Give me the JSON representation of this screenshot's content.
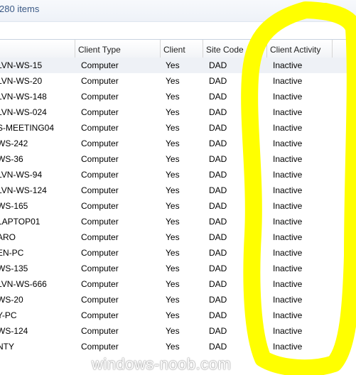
{
  "status": {
    "item_count": "280 items"
  },
  "columns": [
    "Client Type",
    "Client",
    "Site Code",
    "Client Activity"
  ],
  "rows": [
    {
      "name": "LVN-WS-15",
      "client_type": "Computer",
      "client": "Yes",
      "site_code": "DAD",
      "activity": "Inactive"
    },
    {
      "name": "LVN-WS-20",
      "client_type": "Computer",
      "client": "Yes",
      "site_code": "DAD",
      "activity": "Inactive"
    },
    {
      "name": "LVN-WS-148",
      "client_type": "Computer",
      "client": "Yes",
      "site_code": "DAD",
      "activity": "Inactive"
    },
    {
      "name": "LVN-WS-024",
      "client_type": "Computer",
      "client": "Yes",
      "site_code": "DAD",
      "activity": "Inactive"
    },
    {
      "name": "S-MEETING04",
      "client_type": "Computer",
      "client": "Yes",
      "site_code": "DAD",
      "activity": "Inactive"
    },
    {
      "name": "WS-242",
      "client_type": "Computer",
      "client": "Yes",
      "site_code": "DAD",
      "activity": "Inactive"
    },
    {
      "name": "WS-36",
      "client_type": "Computer",
      "client": "Yes",
      "site_code": "DAD",
      "activity": "Inactive"
    },
    {
      "name": "LVN-WS-94",
      "client_type": "Computer",
      "client": "Yes",
      "site_code": "DAD",
      "activity": "Inactive"
    },
    {
      "name": "LVN-WS-124",
      "client_type": "Computer",
      "client": "Yes",
      "site_code": "DAD",
      "activity": "Inactive"
    },
    {
      "name": "WS-165",
      "client_type": "Computer",
      "client": "Yes",
      "site_code": "DAD",
      "activity": "Inactive"
    },
    {
      "name": "LAPTOP01",
      "client_type": "Computer",
      "client": "Yes",
      "site_code": "DAD",
      "activity": "Inactive"
    },
    {
      "name": "ARO",
      "client_type": "Computer",
      "client": "Yes",
      "site_code": "DAD",
      "activity": "Inactive"
    },
    {
      "name": "EN-PC",
      "client_type": "Computer",
      "client": "Yes",
      "site_code": "DAD",
      "activity": "Inactive"
    },
    {
      "name": "WS-135",
      "client_type": "Computer",
      "client": "Yes",
      "site_code": "DAD",
      "activity": "Inactive"
    },
    {
      "name": "LVN-WS-666",
      "client_type": "Computer",
      "client": "Yes",
      "site_code": "DAD",
      "activity": "Inactive"
    },
    {
      "name": "WS-20",
      "client_type": "Computer",
      "client": "Yes",
      "site_code": "DAD",
      "activity": "Inactive"
    },
    {
      "name": "Y-PC",
      "client_type": "Computer",
      "client": "Yes",
      "site_code": "DAD",
      "activity": "Inactive"
    },
    {
      "name": "WS-124",
      "client_type": "Computer",
      "client": "Yes",
      "site_code": "DAD",
      "activity": "Inactive"
    },
    {
      "name": "NTY",
      "client_type": "Computer",
      "client": "Yes",
      "site_code": "DAD",
      "activity": "Inactive"
    }
  ],
  "watermark": "windows-noob.com",
  "colors": {
    "highlight": "#ffff00",
    "link_text": "#3c5a86"
  }
}
